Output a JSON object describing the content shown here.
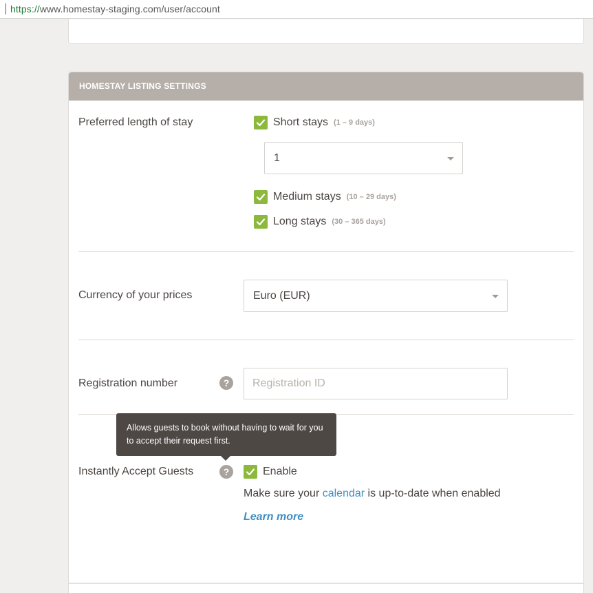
{
  "browser": {
    "url_scheme": "https://",
    "url_rest": "www.homestay-staging.com/user/account"
  },
  "panel": {
    "title": "HOMESTAY LISTING SETTINGS"
  },
  "stay": {
    "label": "Preferred length of stay",
    "options": [
      {
        "label": "Short stays",
        "range": "(1 – 9 days)",
        "checked": true
      },
      {
        "label": "Medium stays",
        "range": "(10 – 29 days)",
        "checked": true
      },
      {
        "label": "Long stays",
        "range": "(30 – 365 days)",
        "checked": true
      }
    ],
    "short_min_nights": "1"
  },
  "currency": {
    "label": "Currency of your prices",
    "selected": "Euro (EUR)"
  },
  "registration": {
    "label": "Registration number",
    "placeholder": "Registration ID"
  },
  "instant": {
    "label": "Instantly Accept Guests",
    "tooltip": "Allows guests to book without having to wait for you to accept their request first.",
    "enable_label": "Enable",
    "enabled": true,
    "note_before": "Make sure your ",
    "note_link": "calendar",
    "note_after": " is up-to-date when enabled",
    "learn_more": "Learn more"
  },
  "icons": {
    "check": "check-icon",
    "help": "question-icon",
    "dropdown": "caret-down-icon"
  },
  "colors": {
    "accent_green": "#8cb83c",
    "header_bg": "#b6afa9",
    "link_blue": "#3e8fc2",
    "tooltip_bg": "#4e4845"
  }
}
